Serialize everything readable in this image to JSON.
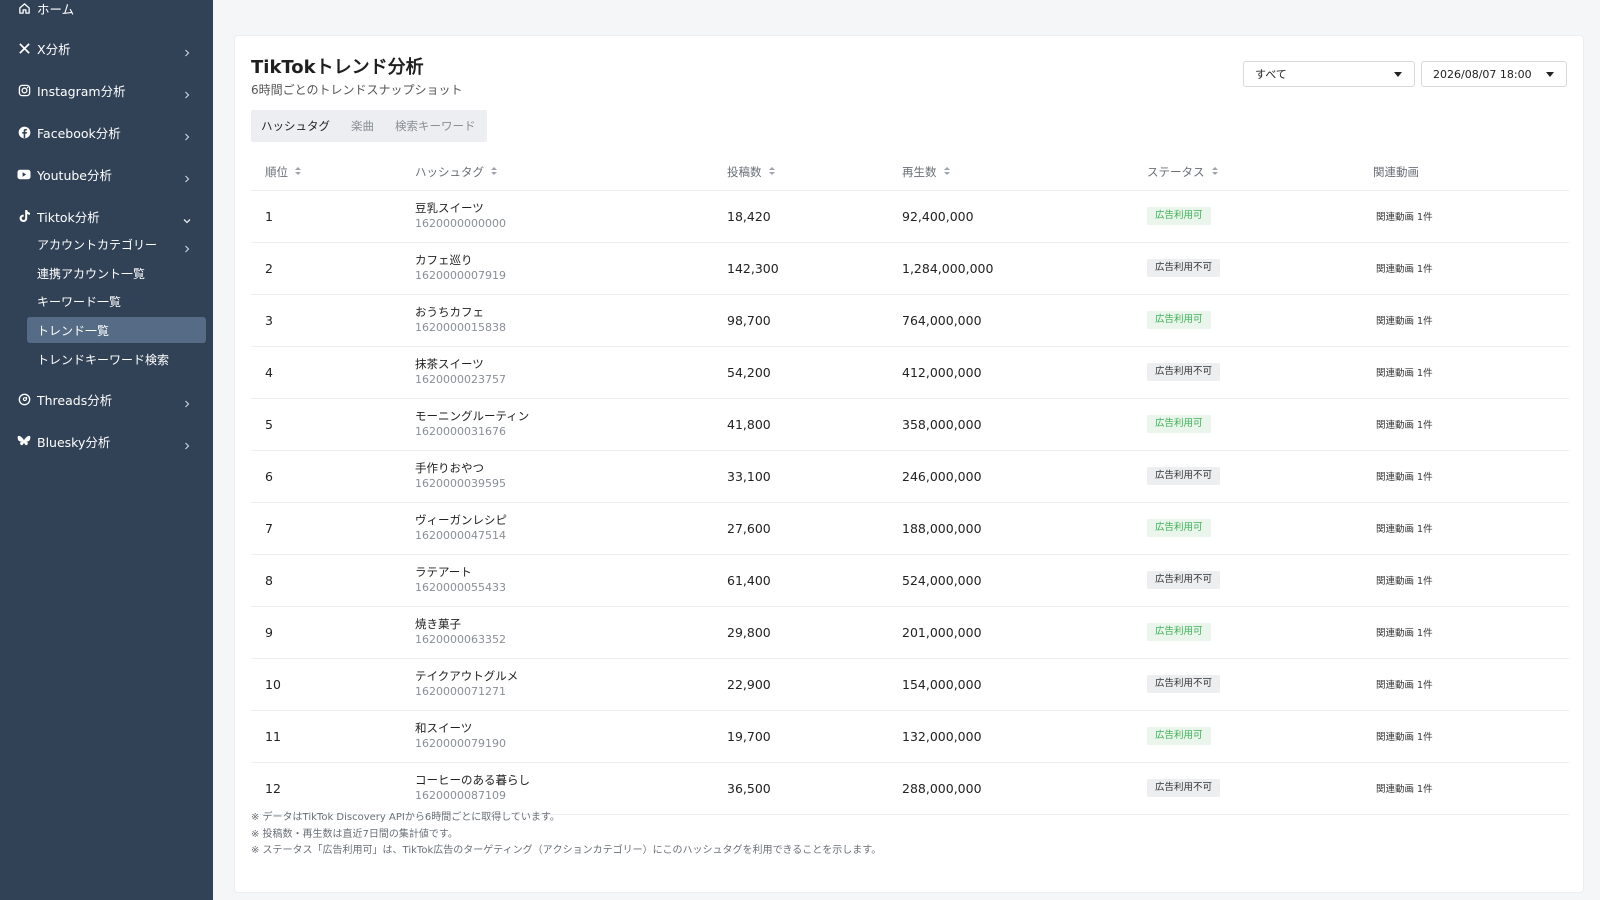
{
  "sidebar": {
    "items": [
      {
        "label": "ホーム",
        "icon": "home-icon"
      },
      {
        "label": "X分析",
        "icon": "x-logo-icon"
      },
      {
        "label": "Instagram分析",
        "icon": "instagram-icon"
      },
      {
        "label": "Facebook分析",
        "icon": "facebook-icon"
      },
      {
        "label": "Youtube分析",
        "icon": "youtube-icon"
      },
      {
        "label": "Tiktok分析",
        "icon": "tiktok-icon",
        "expanded": true
      },
      {
        "label": "Threads分析",
        "icon": "threads-icon"
      },
      {
        "label": "Bluesky分析",
        "icon": "bluesky-icon"
      }
    ],
    "tiktok_sub": [
      {
        "label": "アカウントカテゴリー"
      },
      {
        "label": "連携アカウント一覧"
      },
      {
        "label": "キーワード一覧"
      },
      {
        "label": "トレンド一覧",
        "active": true
      },
      {
        "label": "トレンドキーワード検索"
      }
    ]
  },
  "header": {
    "title": "TikTokトレンド分析",
    "subtitle": "6時間ごとのトレンドスナップショット",
    "filter_value": "すべて",
    "datetime_value": "2026/08/07 18:00"
  },
  "tabs": [
    {
      "label": "ハッシュタグ",
      "active": true
    },
    {
      "label": "楽曲",
      "active": false
    },
    {
      "label": "検索キーワード",
      "active": false
    }
  ],
  "table": {
    "columns": [
      "順位",
      "ハッシュタグ",
      "投稿数",
      "再生数",
      "ステータス",
      "関連動画"
    ],
    "rows": [
      {
        "rank": "1",
        "tag": "豆乳スイーツ",
        "id": "1620000000000",
        "posts": "18,420",
        "views": "92,400,000",
        "status": "広告利用可",
        "ok": true,
        "related": "関連動画 1件"
      },
      {
        "rank": "2",
        "tag": "カフェ巡り",
        "id": "1620000007919",
        "posts": "142,300",
        "views": "1,284,000,000",
        "status": "広告利用不可",
        "ok": false,
        "related": "関連動画 1件"
      },
      {
        "rank": "3",
        "tag": "おうちカフェ",
        "id": "1620000015838",
        "posts": "98,700",
        "views": "764,000,000",
        "status": "広告利用可",
        "ok": true,
        "related": "関連動画 1件"
      },
      {
        "rank": "4",
        "tag": "抹茶スイーツ",
        "id": "1620000023757",
        "posts": "54,200",
        "views": "412,000,000",
        "status": "広告利用不可",
        "ok": false,
        "related": "関連動画 1件"
      },
      {
        "rank": "5",
        "tag": "モーニングルーティン",
        "id": "1620000031676",
        "posts": "41,800",
        "views": "358,000,000",
        "status": "広告利用可",
        "ok": true,
        "related": "関連動画 1件"
      },
      {
        "rank": "6",
        "tag": "手作りおやつ",
        "id": "1620000039595",
        "posts": "33,100",
        "views": "246,000,000",
        "status": "広告利用不可",
        "ok": false,
        "related": "関連動画 1件"
      },
      {
        "rank": "7",
        "tag": "ヴィーガンレシピ",
        "id": "1620000047514",
        "posts": "27,600",
        "views": "188,000,000",
        "status": "広告利用可",
        "ok": true,
        "related": "関連動画 1件"
      },
      {
        "rank": "8",
        "tag": "ラテアート",
        "id": "1620000055433",
        "posts": "61,400",
        "views": "524,000,000",
        "status": "広告利用不可",
        "ok": false,
        "related": "関連動画 1件"
      },
      {
        "rank": "9",
        "tag": "焼き菓子",
        "id": "1620000063352",
        "posts": "29,800",
        "views": "201,000,000",
        "status": "広告利用可",
        "ok": true,
        "related": "関連動画 1件"
      },
      {
        "rank": "10",
        "tag": "テイクアウトグルメ",
        "id": "1620000071271",
        "posts": "22,900",
        "views": "154,000,000",
        "status": "広告利用不可",
        "ok": false,
        "related": "関連動画 1件"
      },
      {
        "rank": "11",
        "tag": "和スイーツ",
        "id": "1620000079190",
        "posts": "19,700",
        "views": "132,000,000",
        "status": "広告利用可",
        "ok": true,
        "related": "関連動画 1件"
      },
      {
        "rank": "12",
        "tag": "コーヒーのある暮らし",
        "id": "1620000087109",
        "posts": "36,500",
        "views": "288,000,000",
        "status": "広告利用不可",
        "ok": false,
        "related": "関連動画 1件"
      }
    ]
  },
  "notes": [
    "※ データはTikTok Discovery APIから6時間ごとに取得しています。",
    "※ 投稿数・再生数は直近7日間の集計値です。",
    "※ ステータス「広告利用可」は、TikTok広告のターゲティング（アクションカテゴリー）にこのハッシュタグを利用できることを示します。"
  ],
  "colors": {
    "sidebar_bg": "#314156",
    "sidebar_active": "#566c86",
    "badge_ok_text": "#3bb054",
    "badge_ok_bg": "#eaf6ec",
    "badge_ng_bg": "#eceef0"
  }
}
